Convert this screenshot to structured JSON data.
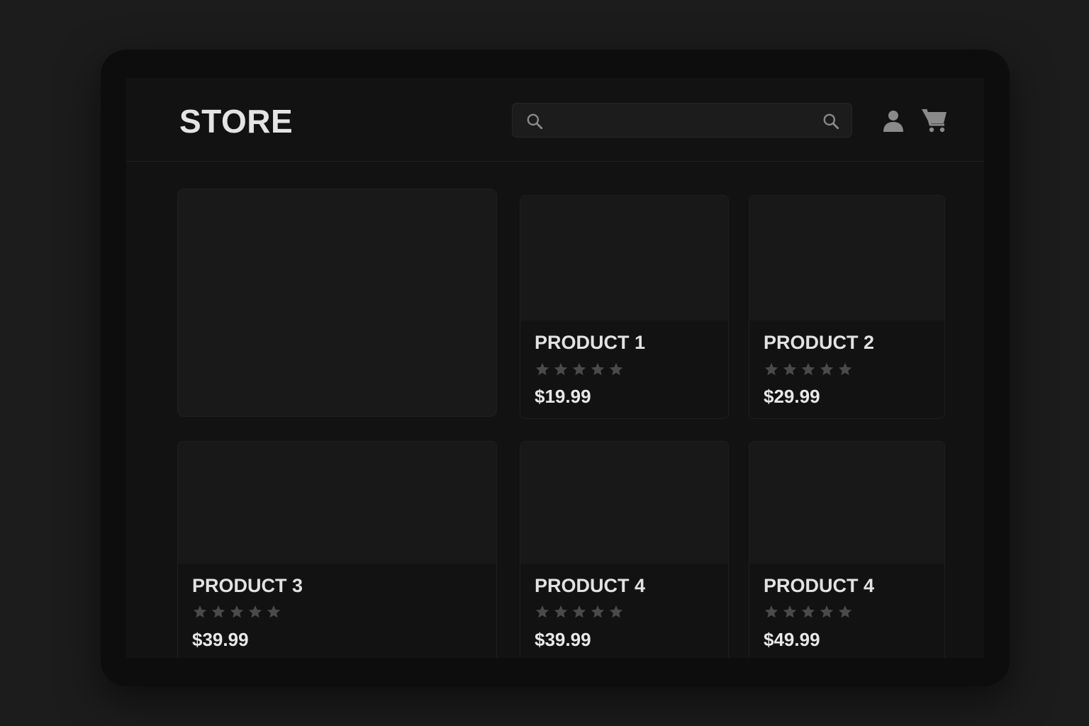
{
  "header": {
    "logo": "STORE",
    "search": {
      "placeholder": "",
      "value": ""
    },
    "icons": {
      "search": "search-icon",
      "user": "user-icon",
      "cart": "cart-icon"
    }
  },
  "products": [
    {
      "name": "PRODUCT 1",
      "price": "$19.99",
      "rating": 5
    },
    {
      "name": "PRODUCT 2",
      "price": "$29.99",
      "rating": 5
    },
    {
      "name": "PRODUCT 3",
      "price": "$39.99",
      "rating": 5
    },
    {
      "name": "PRODUCT 4",
      "price": "$39.99",
      "rating": 5
    },
    {
      "name": "PRODUCT 4",
      "price": "$49.99",
      "rating": 5
    }
  ],
  "colors": {
    "background": "#1c1c1c",
    "surface": "#121212",
    "card": "#161616",
    "text": "#e4e4e4",
    "star": "#4a4a4a",
    "icon": "#8a8a8a"
  }
}
